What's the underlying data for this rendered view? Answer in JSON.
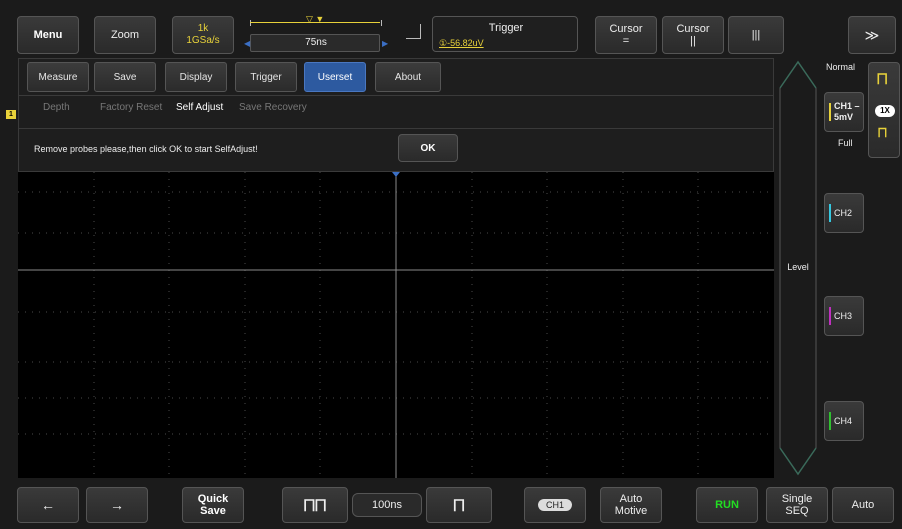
{
  "topbar": {
    "menu": "Menu",
    "zoom": "Zoom",
    "sample_rate": "1k",
    "sample_speed": "1GSa/s",
    "timebase_offset": "75ns",
    "trigger_title": "Trigger",
    "trigger_value": "①-56.82uV",
    "cursor1": "Cursor",
    "cursor1_sym": "=",
    "cursor2": "Cursor",
    "cursor2_sym": "||",
    "menu3_sym": "|||",
    "collapse_sym": "≫"
  },
  "tabs": [
    {
      "label": "Measure"
    },
    {
      "label": "Save"
    },
    {
      "label": "Display"
    },
    {
      "label": "Trigger"
    },
    {
      "label": "Userset"
    },
    {
      "label": "About"
    }
  ],
  "subtabs": [
    {
      "label": "Depth"
    },
    {
      "label": "Factory Reset"
    },
    {
      "label": "Self Adjust"
    },
    {
      "label": "Save Recovery"
    }
  ],
  "message": {
    "text": "Remove probes please,then click OK to start SelfAdjust!",
    "ok": "OK"
  },
  "marker": "1",
  "right": {
    "mode": "Normal",
    "ch1_name": "CH1",
    "ch1_scale": "5mV",
    "ch1_full": "Full",
    "probe": "1X",
    "ch2": "CH2",
    "ch3": "CH3",
    "ch4": "CH4",
    "level": "Level"
  },
  "colors": {
    "ch1": "#e8d23a",
    "ch2": "#36c8e0",
    "ch3": "#c030c0",
    "ch4": "#30c030",
    "active_tab": "#2d5aa0",
    "run": "#22dd22"
  },
  "bottombar": {
    "back": "←",
    "forward": "→",
    "quick_save": "Quick\nSave",
    "timebase": "100ns",
    "channel": "CH1",
    "auto_motive": "Auto\nMotive",
    "run": "RUN",
    "single": "Single\nSEQ",
    "auto": "Auto"
  }
}
